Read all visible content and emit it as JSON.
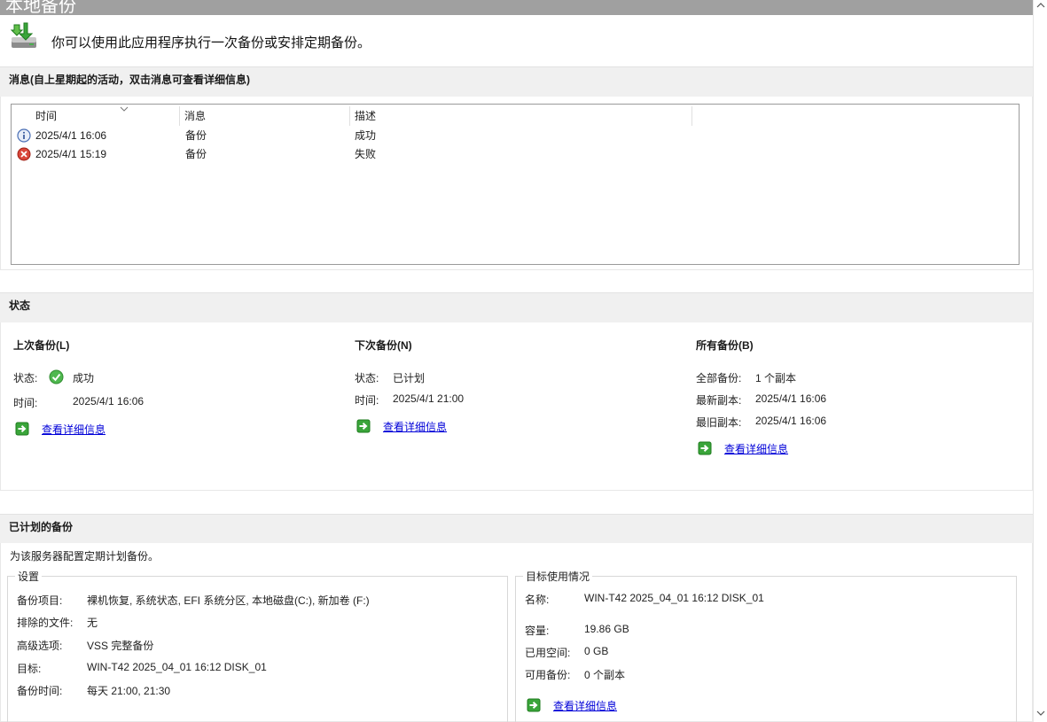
{
  "window": {
    "title": "本地备份"
  },
  "intro": {
    "icon": "backup-drive-icon",
    "text": "你可以使用此应用程序执行一次备份或安排定期备份。"
  },
  "messages": {
    "header": "消息(自上星期起的活动，双击消息可查看详细信息)",
    "columns": [
      "时间",
      "消息",
      "描述"
    ],
    "rows": [
      {
        "icon": "info-icon",
        "time": "2025/4/1 16:06",
        "message": "备份",
        "description": "成功"
      },
      {
        "icon": "error-icon",
        "time": "2025/4/1 15:19",
        "message": "备份",
        "description": "失败"
      }
    ]
  },
  "status": {
    "header": "状态",
    "last_backup": {
      "title": "上次备份(L)",
      "status_label": "状态:",
      "status_value": "成功",
      "time_label": "时间:",
      "time_value": "2025/4/1 16:06",
      "link": "查看详细信息"
    },
    "next_backup": {
      "title": "下次备份(N)",
      "status_label": "状态:",
      "status_value": "已计划",
      "time_label": "时间:",
      "time_value": "2025/4/1 21:00",
      "link": "查看详细信息"
    },
    "all_backups": {
      "title": "所有备份(B)",
      "total_label": "全部备份:",
      "total_value": "1 个副本",
      "latest_label": "最新副本:",
      "latest_value": "2025/4/1 16:06",
      "oldest_label": "最旧副本:",
      "oldest_value": "2025/4/1 16:06",
      "link": "查看详细信息"
    }
  },
  "scheduled": {
    "header": "已计划的备份",
    "description": "为该服务器配置定期计划备份。",
    "settings": {
      "title": "设置",
      "items_label": "备份项目:",
      "items_value": "裸机恢复, 系统状态, EFI 系统分区, 本地磁盘(C:), 新加卷 (F:)",
      "excluded_label": "排除的文件:",
      "excluded_value": "无",
      "advanced_label": "高级选项:",
      "advanced_value": "VSS 完整备份",
      "target_label": "目标:",
      "target_value": "WIN-T42 2025_04_01 16:12 DISK_01",
      "time_label": "备份时间:",
      "time_value": "每天 21:00, 21:30"
    },
    "target_usage": {
      "title": "目标使用情况",
      "name_label": "名称:",
      "name_value": "WIN-T42 2025_04_01 16:12 DISK_01",
      "capacity_label": "容量:",
      "capacity_value": "19.86 GB",
      "used_label": "已用空间:",
      "used_value": "0 GB",
      "available_label": "可用备份:",
      "available_value": "0 个副本",
      "link": "查看详细信息"
    }
  },
  "colors": {
    "link": "#0000d8",
    "header_bg": "#f0f0f0",
    "title_bg": "#a0a0a0",
    "success": "#3aa53a",
    "error": "#c42b1c",
    "info": "#4a6fb5"
  }
}
